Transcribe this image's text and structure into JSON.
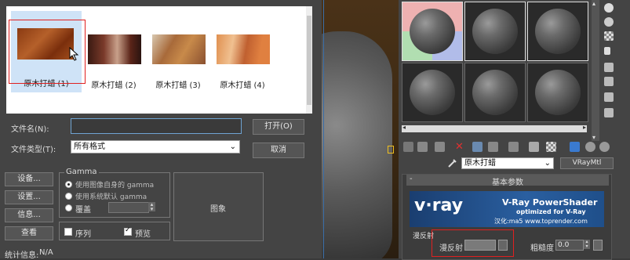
{
  "dialog": {
    "thumbnails": [
      {
        "caption": "原木打蜡 (1)"
      },
      {
        "caption": "原木打蜡 (2)"
      },
      {
        "caption": "原木打蜡 (3)"
      },
      {
        "caption": "原木打蜡 (4)"
      }
    ],
    "filename_label": "文件名(N):",
    "filename_value": "",
    "filetype_label": "文件类型(T):",
    "filetype_value": "所有格式",
    "open_button": "打开(O)",
    "cancel_button": "取消",
    "setup_button": "设备...",
    "settings_button": "设置...",
    "info_button": "信息...",
    "view_button": "查看",
    "gamma": {
      "title": "Gamma",
      "option_image": "使用图像自身的 gamma",
      "option_system": "使用系统默认 gamma",
      "option_override": "覆盖"
    },
    "sequence_label": "序列",
    "preview_label": "预览",
    "preview_box_label": "图象",
    "stats_label": "统计信息:",
    "stats_value": "N/A"
  },
  "material_editor": {
    "material_name": "原木打蜡",
    "material_type": "VRayMtl",
    "rollout_title": "基本参数",
    "banner_brand": "v·ray",
    "banner_title": "V-Ray PowerShader",
    "banner_subtitle": "optimized for V-Ray",
    "banner_credit": "汉化:ma5 www.toprender.com",
    "diffuse_group": "漫反射",
    "diffuse_label": "漫反射",
    "roughness_label": "粗糙度",
    "roughness_value": "0.0"
  },
  "colors": {
    "selection_red": "#e02020",
    "highlight_blue": "#cfe3f7",
    "vray_banner": "#1f4f8a"
  }
}
